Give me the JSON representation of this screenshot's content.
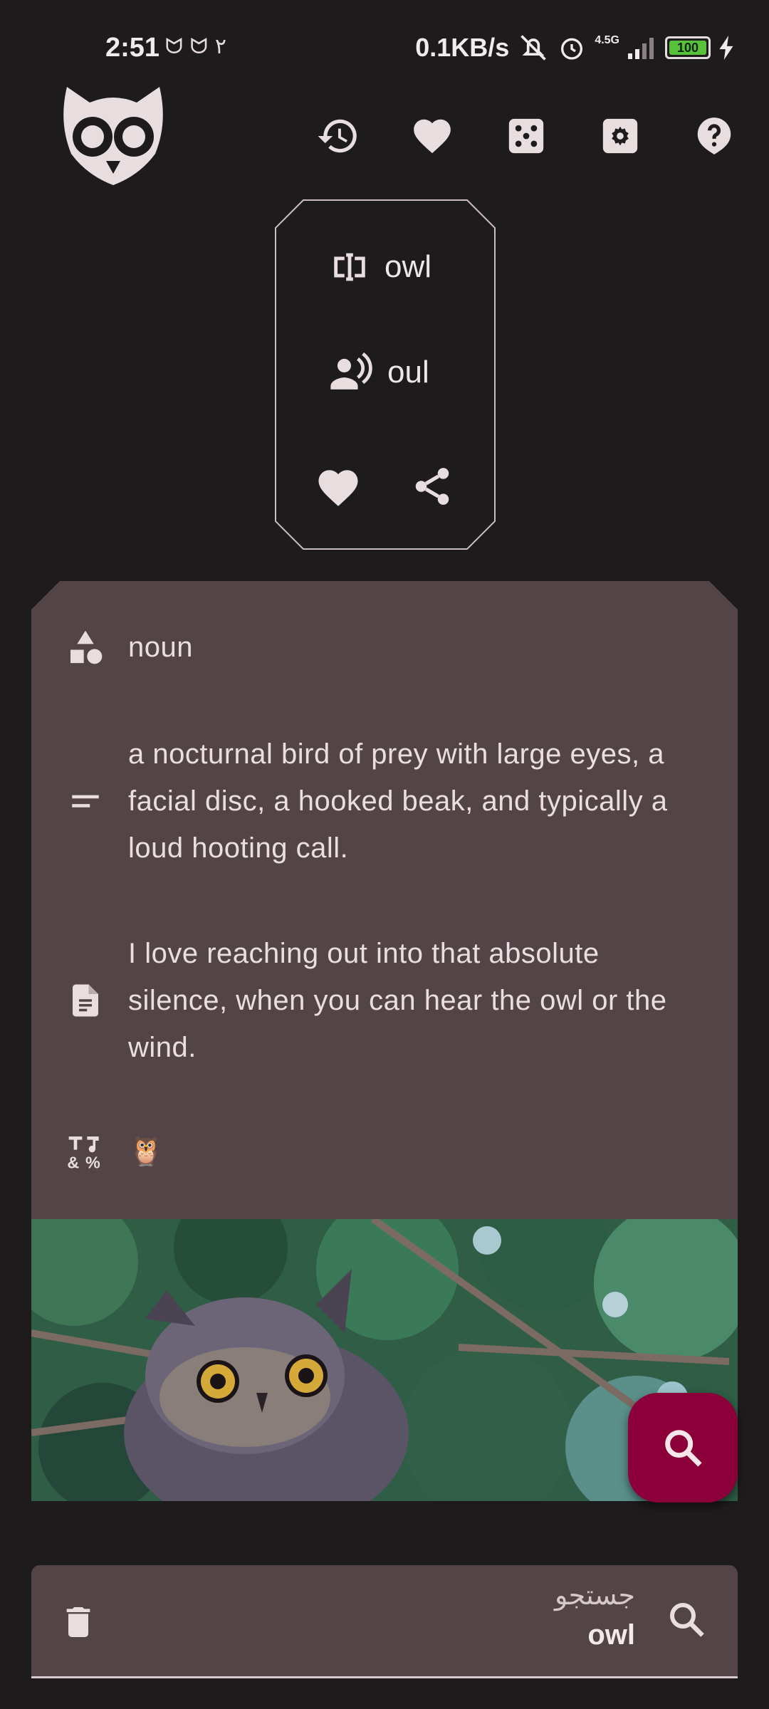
{
  "status_bar": {
    "time": "2:51",
    "left_extra": "۲",
    "net_speed": "0.1KB/s",
    "network_type": "4.5G",
    "battery": "100",
    "icons": [
      "sim-icon",
      "sim-icon",
      "mute-icon",
      "alarm-icon",
      "signal-icon",
      "battery-icon",
      "charging-icon"
    ]
  },
  "toolbar": {
    "icons": [
      "history-icon",
      "favorites-icon",
      "random-icon",
      "settings-icon",
      "help-icon"
    ]
  },
  "word_card": {
    "word": "owl",
    "pronunciation": "oul"
  },
  "definition": {
    "part_of_speech": "noun",
    "meaning": "a nocturnal bird of prey with large eyes, a facial disc, a hooked beak, and typically a loud hooting call.",
    "example": "I love reaching out into that absolute silence, when you can hear the owl or the wind.",
    "emoji": "🦉"
  },
  "search": {
    "label": "جستجو",
    "value": "owl"
  },
  "colors": {
    "background": "#1e1b1c",
    "card": "#524447",
    "fab": "#8b0039",
    "icon": "#e9dedf"
  }
}
